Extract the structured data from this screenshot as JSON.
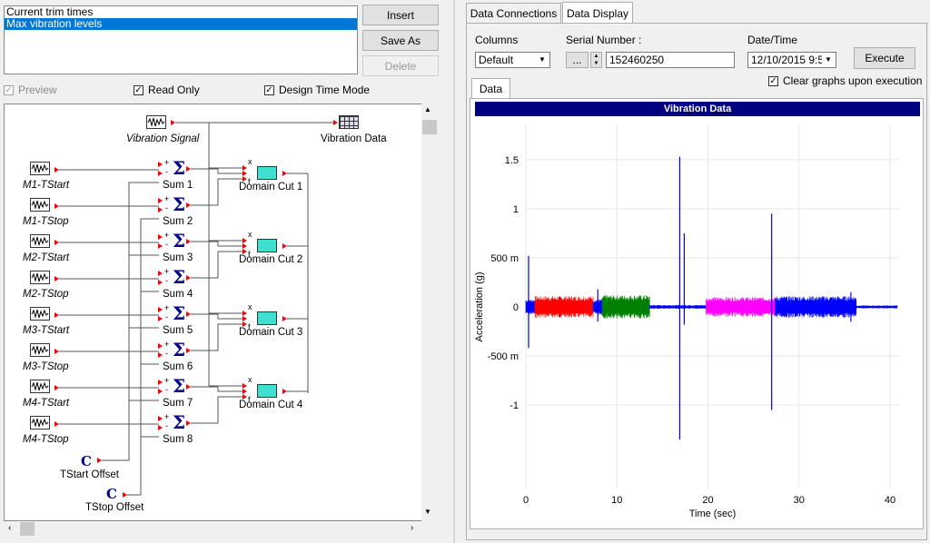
{
  "list": {
    "items": [
      {
        "label": "Current trim times",
        "selected": false
      },
      {
        "label": "Max vibration levels",
        "selected": true
      }
    ]
  },
  "buttons": {
    "insert": "Insert",
    "save_as": "Save As",
    "delete": "Delete",
    "execute": "Execute"
  },
  "options": {
    "preview": "Preview",
    "read_only": "Read Only",
    "design_time": "Design Time Mode"
  },
  "diagram": {
    "vibration_signal": "Vibration Signal",
    "vibration_data": "Vibration Data",
    "inputs": [
      "M1-TStart",
      "M1-TStop",
      "M2-TStart",
      "M2-TStop",
      "M3-TStart",
      "M3-TStop",
      "M4-TStart",
      "M4-TStop"
    ],
    "sums": [
      "Sum 1",
      "Sum 2",
      "Sum 3",
      "Sum 4",
      "Sum 5",
      "Sum 6",
      "Sum 7",
      "Sum 8"
    ],
    "cuts": [
      "Domain Cut 1",
      "Domain Cut 2",
      "Domain Cut 3",
      "Domain Cut 4"
    ],
    "tstart_offset": "TStart Offset",
    "tstop_offset": "TStop Offset",
    "const_symbol": "C",
    "plus": "+",
    "minus": "-",
    "sigma": "Σ",
    "x": "x",
    "f": "f"
  },
  "tabs": {
    "connections": "Data Connections",
    "display": "Data Display",
    "data": "Data"
  },
  "controls": {
    "columns_label": "Columns",
    "columns_value": "Default",
    "serial_label": "Serial Number :",
    "serial_value": "152460250",
    "ellipsis": "...",
    "datetime_label": "Date/Time",
    "datetime_value": "12/10/2015 9:5",
    "clear_graphs": "Clear graphs upon execution"
  },
  "colors": {
    "title_bar": "#000080",
    "red": "#ff0000",
    "green": "#008000",
    "magenta": "#ff00ff",
    "blue": "#0000ff"
  },
  "chart_data": {
    "type": "line",
    "title": "Vibration Data",
    "xlabel": "Time (sec)",
    "ylabel": "Acceleration (g)",
    "xlim": [
      0,
      41
    ],
    "ylim": [
      -1.85,
      1.85
    ],
    "xticks": [
      {
        "v": 0,
        "l": "0"
      },
      {
        "v": 10,
        "l": "10"
      },
      {
        "v": 20,
        "l": "20"
      },
      {
        "v": 30,
        "l": "30"
      },
      {
        "v": 40,
        "l": "40"
      }
    ],
    "yticks": [
      {
        "v": 1.5,
        "l": "1.5"
      },
      {
        "v": 1,
        "l": "1"
      },
      {
        "v": 0.5,
        "l": "500 m"
      },
      {
        "v": 0,
        "l": "0"
      },
      {
        "v": -0.5,
        "l": "-500 m"
      },
      {
        "v": -1,
        "l": "-1"
      }
    ],
    "grid": true,
    "segments": [
      {
        "color": "blue",
        "x": [
          0,
          1.0
        ],
        "amp": 0.08
      },
      {
        "color": "red",
        "x": [
          1.0,
          7.4
        ],
        "amp": 0.11
      },
      {
        "color": "blue",
        "x": [
          7.4,
          8.4
        ],
        "amp": 0.08
      },
      {
        "color": "green",
        "x": [
          8.4,
          13.6
        ],
        "amp": 0.12
      },
      {
        "color": "blue",
        "x": [
          13.6,
          19.8
        ],
        "amp": 0.02
      },
      {
        "color": "magenta",
        "x": [
          19.8,
          27.4
        ],
        "amp": 0.1
      },
      {
        "color": "blue",
        "x": [
          27.4,
          36.3
        ],
        "amp": 0.11
      },
      {
        "color": "blue",
        "x": [
          36.3,
          40.8
        ],
        "amp": 0.015
      }
    ],
    "spikes": [
      {
        "x": 0.3,
        "ymin": -0.42,
        "ymax": 0.52
      },
      {
        "x": 7.9,
        "ymin": -0.15,
        "ymax": 0.18
      },
      {
        "x": 16.9,
        "ymin": -1.35,
        "ymax": 1.53
      },
      {
        "x": 17.4,
        "ymin": -0.18,
        "ymax": 0.75
      },
      {
        "x": 27.0,
        "ymin": -1.05,
        "ymax": 0.95
      },
      {
        "x": 35.7,
        "ymin": -0.15,
        "ymax": 0.15
      }
    ]
  }
}
